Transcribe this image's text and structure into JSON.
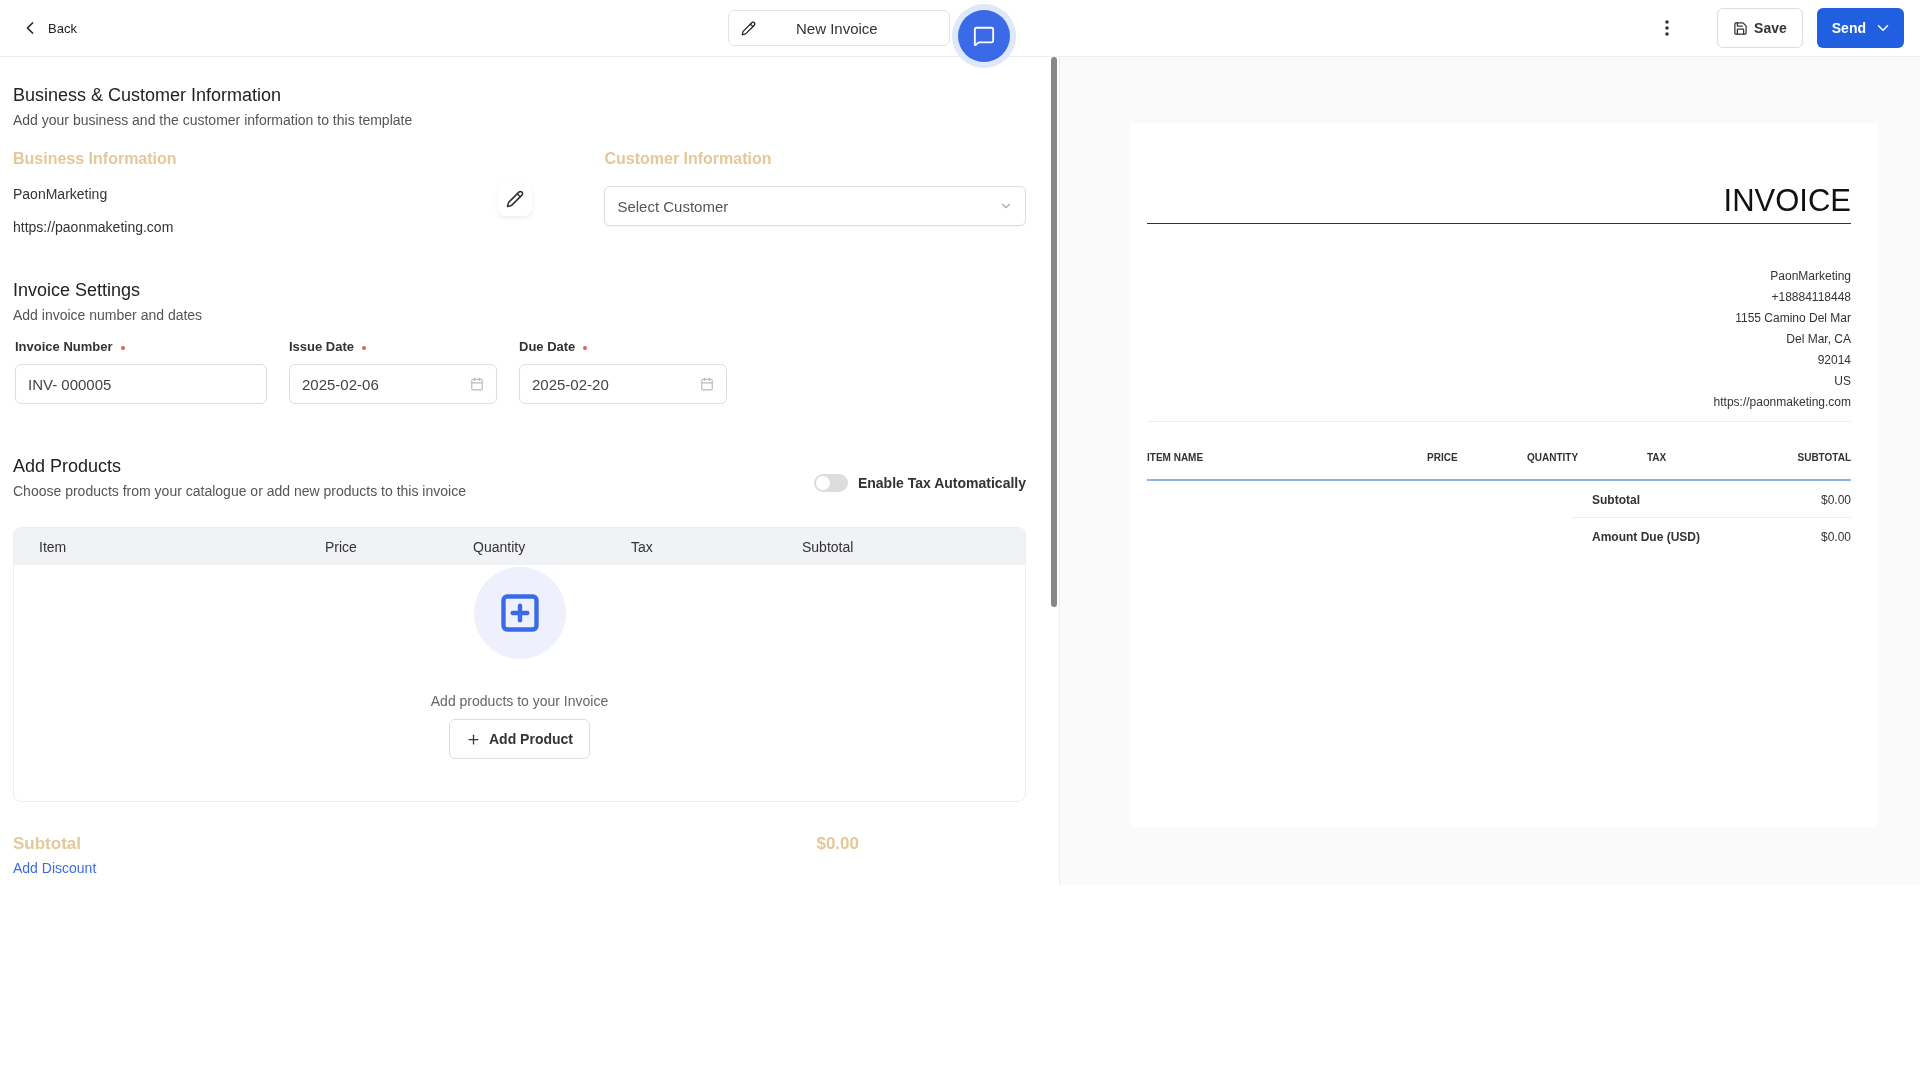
{
  "topbar": {
    "back": "Back",
    "title": "New Invoice",
    "save": "Save",
    "send": "Send"
  },
  "business_customer": {
    "title": "Business & Customer Information",
    "subtitle": "Add your business and the customer information to this template",
    "business_heading": "Business Information",
    "business_name": "PaonMarketing",
    "business_url": "https://paonmaketing.com",
    "customer_heading": "Customer Information",
    "customer_select": {
      "placeholder": "Select Customer"
    }
  },
  "invoice_settings": {
    "title": "Invoice Settings",
    "subtitle": "Add invoice number and dates",
    "fields": [
      {
        "label": "Invoice Number",
        "required": true,
        "value": "INV- 000005",
        "kind": "text"
      },
      {
        "label": "Issue Date",
        "required": true,
        "value": "2025-02-06",
        "kind": "date"
      },
      {
        "label": "Due Date",
        "required": true,
        "value": "2025-02-20",
        "kind": "date"
      }
    ]
  },
  "products": {
    "title": "Add Products",
    "subtitle": "Choose products from your catalogue or add new products to this invoice",
    "tax_toggle": {
      "label": "Enable Tax Automatically",
      "on": false
    },
    "columns": [
      "Item",
      "Price",
      "Quantity",
      "Tax",
      "Subtotal"
    ],
    "empty_text": "Add products to your Invoice",
    "add_button": "Add Product"
  },
  "totals": {
    "subtotal_label": "Subtotal",
    "subtotal_value": "$0.00",
    "discount_link": "Add Discount"
  },
  "preview": {
    "title": "INVOICE",
    "business_lines": [
      "PaonMarketing",
      "+18884118448",
      "1155 Camino Del Mar",
      "Del Mar, CA",
      "92014",
      "US",
      "https://paonmaketing.com"
    ],
    "columns": [
      "ITEM NAME",
      "PRICE",
      "QUANTITY",
      "TAX",
      "SUBTOTAL"
    ],
    "totals": [
      {
        "label": "Subtotal",
        "value": "$0.00"
      },
      {
        "label": "Amount Due (USD)",
        "value": "$0.00"
      }
    ]
  }
}
